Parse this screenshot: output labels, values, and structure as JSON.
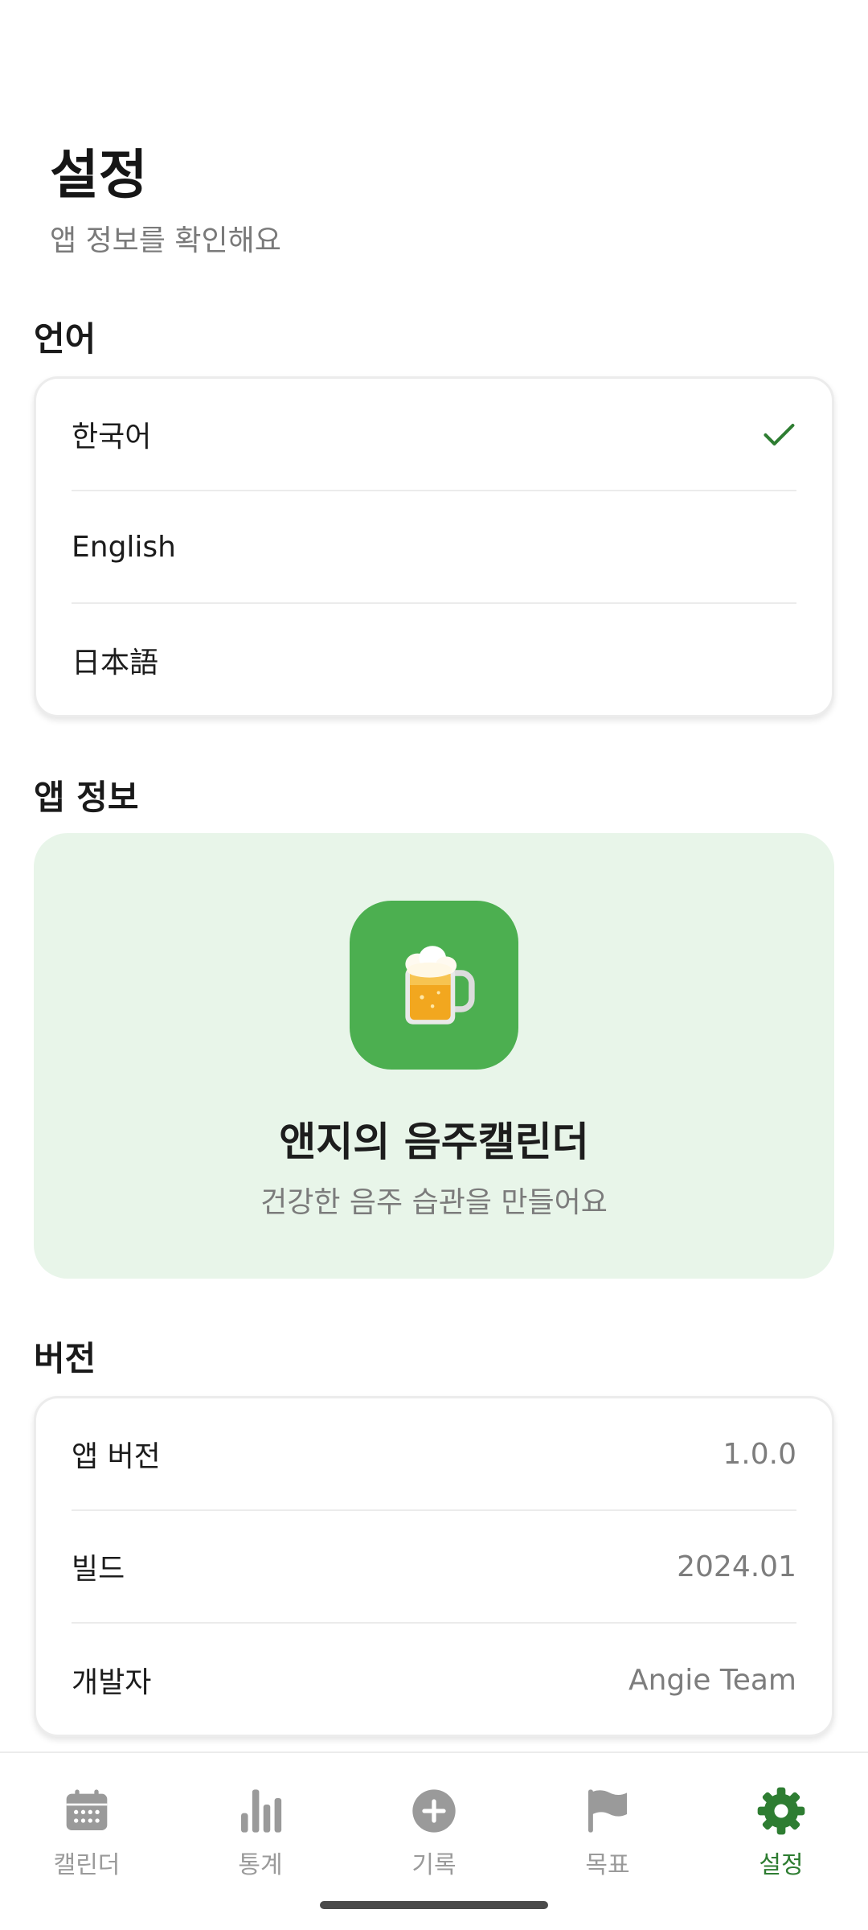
{
  "header": {
    "title": "설정",
    "subtitle": "앱 정보를 확인해요"
  },
  "language": {
    "title": "언어",
    "options": [
      {
        "label": "한국어",
        "selected": true
      },
      {
        "label": "English",
        "selected": false
      },
      {
        "label": "日本語",
        "selected": false
      }
    ]
  },
  "app_info": {
    "title": "앱 정보",
    "app_icon": "beer-mug-icon",
    "app_name": "앤지의 음주캘린더",
    "tagline": "건강한 음주 습관을 만들어요"
  },
  "version": {
    "title": "버전",
    "rows": [
      {
        "label": "앱 버전",
        "value": "1.0.0"
      },
      {
        "label": "빌드",
        "value": "2024.01"
      },
      {
        "label": "개발자",
        "value": "Angie Team"
      }
    ]
  },
  "bottom_nav": {
    "items": [
      {
        "label": "캘린더",
        "icon": "calendar-icon"
      },
      {
        "label": "통계",
        "icon": "bar-chart-icon"
      },
      {
        "label": "기록",
        "icon": "add-circle-icon"
      },
      {
        "label": "목표",
        "icon": "flag-icon"
      },
      {
        "label": "설정",
        "icon": "gear-icon",
        "active": true
      }
    ]
  },
  "colors": {
    "accent": "#2e7d32",
    "app_icon_bg": "#4caf50",
    "app_card_bg": "#e8f5e9",
    "nav_inactive": "#9a9a9a"
  }
}
